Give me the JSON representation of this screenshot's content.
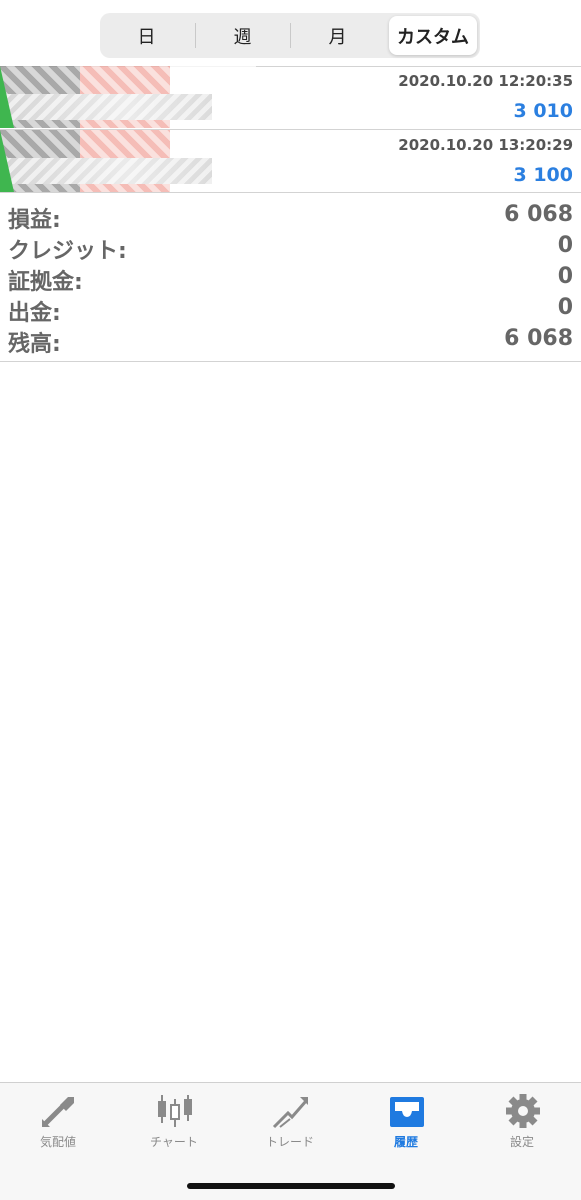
{
  "segments": {
    "day": "日",
    "week": "週",
    "month": "月",
    "custom": "カスタム",
    "selected": "custom"
  },
  "deals": [
    {
      "time": "2020.10.20 12:20:35",
      "profit": "3 010"
    },
    {
      "time": "2020.10.20 13:20:29",
      "profit": "3 100"
    }
  ],
  "summary": {
    "profit_label": "損益:",
    "profit_value": "6 068",
    "credit_label": "クレジット:",
    "credit_value": "0",
    "margin_label": "証拠金:",
    "margin_value": "0",
    "withdrawal_label": "出金:",
    "withdrawal_value": "0",
    "balance_label": "残高:",
    "balance_value": "6 068"
  },
  "tabbar": {
    "quotes": "気配値",
    "chart": "チャート",
    "trade": "トレード",
    "history": "履歴",
    "settings": "設定",
    "active": "history"
  },
  "colors": {
    "accent": "#1f7ae0",
    "profit": "#2b7fe0",
    "buy_marker": "#3fb64f",
    "icon_gray": "#8a8a8a"
  }
}
